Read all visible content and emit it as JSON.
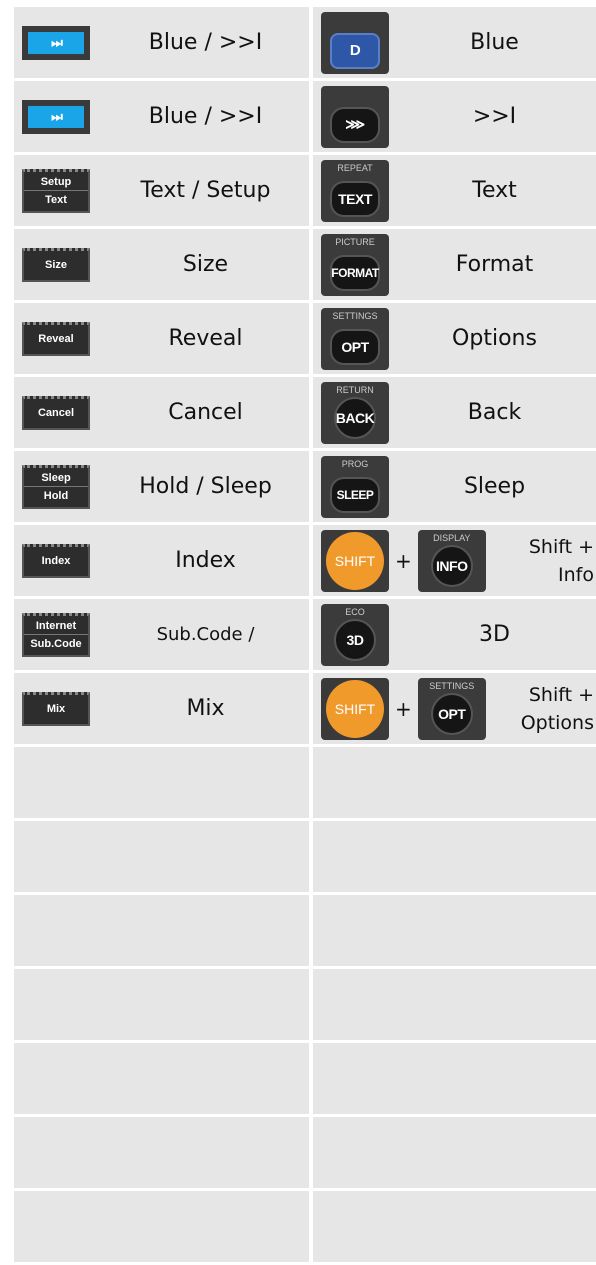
{
  "rows": [
    {
      "left_key": "⏭",
      "left_label": "Blue / >>I",
      "right_key": "D",
      "right_cap": "",
      "right_label": "Blue"
    },
    {
      "left_key": "⏭",
      "left_label": "Blue / >>I",
      "right_key": "⋙",
      "right_cap": "",
      "right_label": ">>I"
    },
    {
      "left_top": "Setup",
      "left_bot": "Text",
      "left_label": "Text / Setup",
      "right_key": "TEXT",
      "right_cap": "REPEAT",
      "right_label": "Text"
    },
    {
      "left_key": "Size",
      "left_label": "Size",
      "right_key": "FORMAT",
      "right_cap": "PICTURE",
      "right_label": "Format"
    },
    {
      "left_key": "Reveal",
      "left_label": "Reveal",
      "right_key": "OPT",
      "right_cap": "SETTINGS",
      "right_label": "Options"
    },
    {
      "left_key": "Cancel",
      "left_label": "Cancel",
      "right_key": "BACK",
      "right_cap": "RETURN",
      "right_label": "Back"
    },
    {
      "left_top": "Sleep",
      "left_bot": "Hold",
      "left_label": "Hold / Sleep",
      "right_key": "SLEEP",
      "right_cap": "PROG",
      "right_label": "Sleep"
    },
    {
      "left_key": "Index",
      "left_label": "Index",
      "shift": "SHIFT",
      "plus": "+",
      "right_key": "INFO",
      "right_cap": "DISPLAY",
      "right_label_1": "Shift +",
      "right_label_2": "Info"
    },
    {
      "left_top": "Internet",
      "left_bot": "Sub.Code",
      "left_label": "Sub.Code /",
      "right_key": "3D",
      "right_cap": "ECO",
      "right_label": "3D"
    },
    {
      "left_key": "Mix",
      "left_label": "Mix",
      "shift": "SHIFT",
      "plus": "+",
      "right_key": "OPT",
      "right_cap": "SETTINGS",
      "right_label_1": "Shift +",
      "right_label_2": "Options"
    }
  ],
  "colors": {
    "cell_bg": "#e6e6e6",
    "blue_key": "#1aa5e8",
    "shift_orange": "#f09a2c"
  }
}
